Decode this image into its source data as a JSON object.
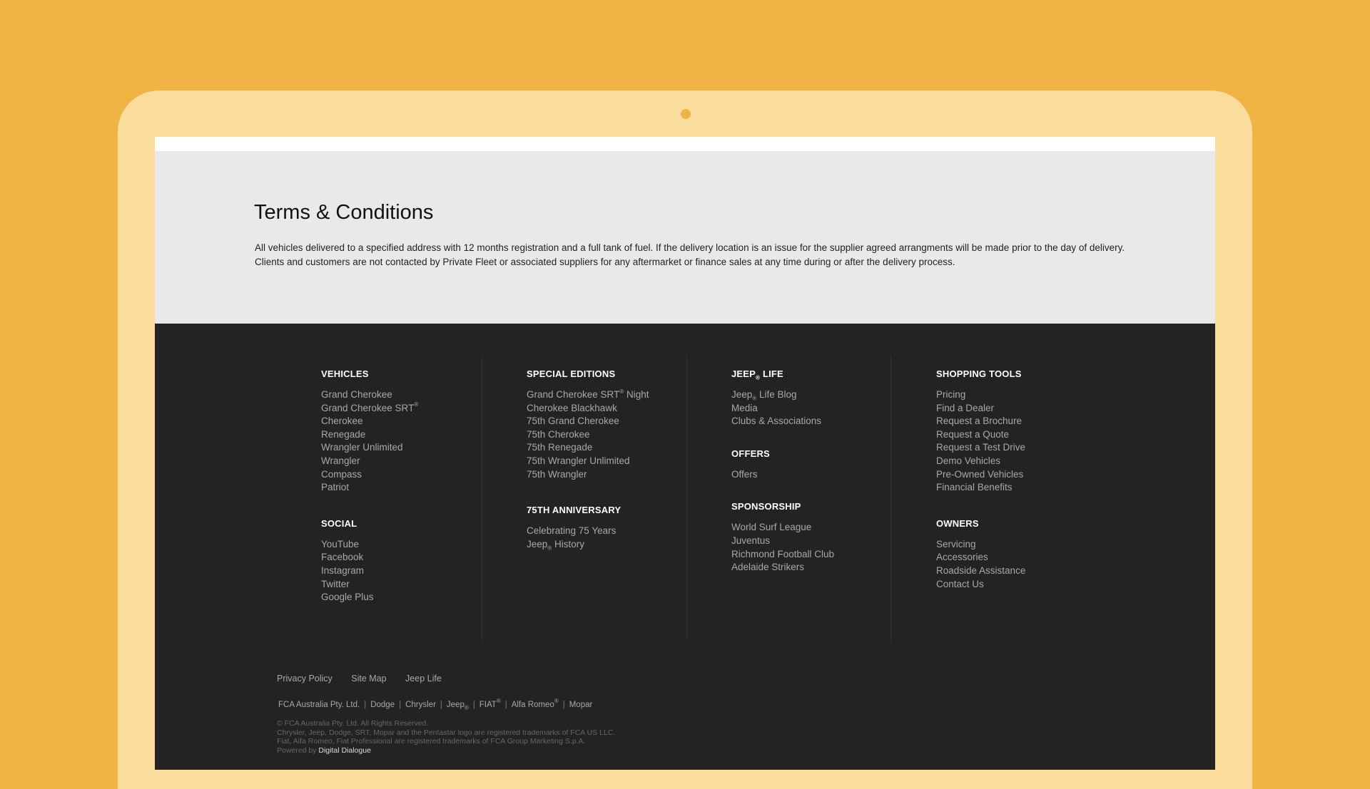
{
  "terms": {
    "title": "Terms & Conditions",
    "body": "All vehicles delivered to a specified address with 12 months registration and a full tank of fuel. If the delivery location is an issue for the supplier agreed arrangments will be made prior to the day of delivery. Clients and customers are not contacted by Private Fleet or associated suppliers for any aftermarket or finance sales at any time during or after the delivery process."
  },
  "footer": {
    "vehicles": {
      "heading": "VEHICLES",
      "items": [
        "Grand Cherokee",
        "Grand Cherokee SRT",
        "Cherokee",
        "Renegade",
        "Wrangler Unlimited",
        "Wrangler",
        "Compass",
        "Patriot"
      ]
    },
    "social": {
      "heading": "SOCIAL",
      "items": [
        "YouTube",
        "Facebook",
        "Instagram",
        "Twitter",
        "Google Plus"
      ]
    },
    "special_editions": {
      "heading": "SPECIAL EDITIONS",
      "items": [
        "Grand Cherokee SRT",
        "Cherokee Blackhawk",
        "75th Grand Cherokee",
        "75th Cherokee",
        "75th Renegade",
        "75th Wrangler Unlimited",
        "75th Wrangler"
      ],
      "night_suffix": " Night"
    },
    "anniversary": {
      "heading": "75TH ANNIVERSARY",
      "items": [
        "Celebrating 75 Years",
        "History"
      ]
    },
    "jeep_life": {
      "heading_a": "JEEP",
      "heading_b": " LIFE",
      "items": [
        "Life Blog",
        "Media",
        "Clubs & Associations"
      ]
    },
    "offers": {
      "heading": "OFFERS",
      "items": [
        "Offers"
      ]
    },
    "sponsorship": {
      "heading": "SPONSORSHIP",
      "items": [
        "World Surf League",
        "Juventus",
        "Richmond Football Club",
        "Adelaide Strikers"
      ]
    },
    "shopping_tools": {
      "heading": "SHOPPING TOOLS",
      "items": [
        "Pricing",
        "Find a Dealer",
        "Request a Brochure",
        "Request a Quote",
        "Request a Test Drive",
        "Demo Vehicles",
        "Pre-Owned Vehicles",
        "Financial Benefits"
      ]
    },
    "owners": {
      "heading": "OWNERS",
      "items": [
        "Servicing",
        "Accessories",
        "Roadside Assistance",
        "Contact Us"
      ]
    },
    "marks": {
      "registered": "®",
      "jeep_word": "Jeep",
      "jeep_mark": "®"
    },
    "legal_links": [
      "Privacy Policy",
      "Site Map",
      "Jeep Life"
    ],
    "brands": [
      "FCA Australia Pty. Ltd.",
      "Dodge",
      "Chrysler",
      "Jeep",
      "FIAT",
      "Alfa Romeo",
      "Mopar"
    ],
    "copyright": [
      "© FCA Australia Pty. Ltd. All Rights Reserved.",
      "Chrysler, Jeep, Dodge, SRT, Mopar and the Pentastar logo are registered trademarks of FCA US LLC.",
      "Fiat, Alfa Romeo, Fiat Professional are registered trademarks of FCA Group Marketing S.p.A."
    ],
    "powered_by": "Powered by",
    "powered_by_name": "Digital Dialogue"
  }
}
